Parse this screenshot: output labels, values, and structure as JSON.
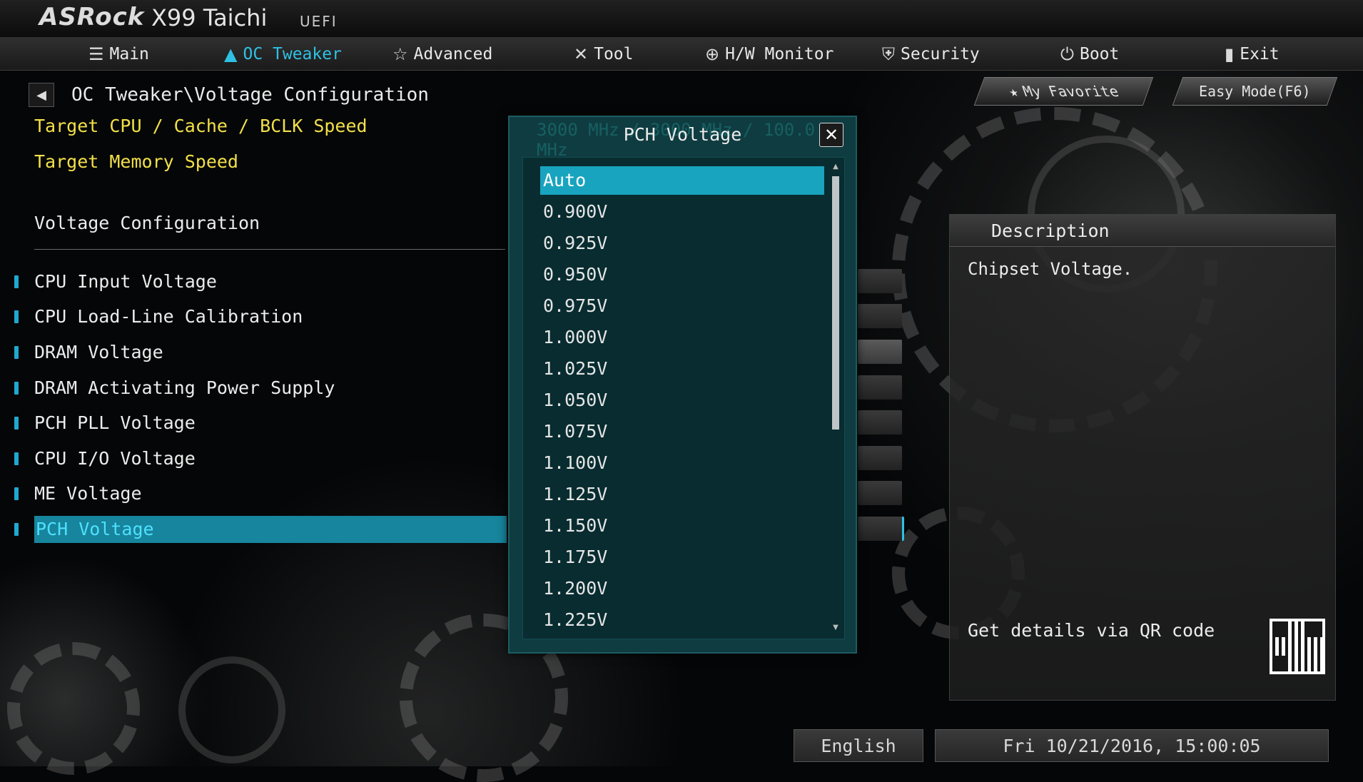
{
  "header": {
    "brand": "ASRock",
    "model": "X99 Taichi",
    "uefi": "UEFI"
  },
  "tabs": [
    {
      "label": "Main",
      "icon": "list-icon"
    },
    {
      "label": "OC Tweaker",
      "icon": "rocket-icon",
      "active": true
    },
    {
      "label": "Advanced",
      "icon": "star-icon"
    },
    {
      "label": "Tool",
      "icon": "tools-icon"
    },
    {
      "label": "H/W Monitor",
      "icon": "crosshair-icon"
    },
    {
      "label": "Security",
      "icon": "shield-icon"
    },
    {
      "label": "Boot",
      "icon": "power-icon"
    },
    {
      "label": "Exit",
      "icon": "exit-door-icon"
    }
  ],
  "breadcrumb": "OC Tweaker\\Voltage Configuration",
  "target_cpu": "Target CPU / Cache / BCLK Speed",
  "target_memory": "Target Memory Speed",
  "section_title": "Voltage Configuration",
  "items": [
    "CPU Input Voltage",
    "CPU Load-Line Calibration",
    "DRAM Voltage",
    "DRAM Activating Power Supply",
    "PCH PLL Voltage",
    "CPU I/O Voltage",
    "ME Voltage",
    "PCH Voltage"
  ],
  "selected_item": "PCH Voltage",
  "top_buttons": {
    "favorite": "My Favorite",
    "easy_mode": "Easy Mode(F6)"
  },
  "description": {
    "title": "Description",
    "text": "Chipset Voltage.",
    "qr_label": "Get details via QR code"
  },
  "status": {
    "language": "English",
    "datetime": "Fri 10/21/2016, 15:00:05"
  },
  "modal": {
    "title": "PCH Voltage",
    "ghost_text": "3000 MHz / 3000 MHz / 100.0 MHz",
    "options": [
      "Auto",
      "0.900V",
      "0.925V",
      "0.950V",
      "0.975V",
      "1.000V",
      "1.025V",
      "1.050V",
      "1.075V",
      "1.100V",
      "1.125V",
      "1.150V",
      "1.175V",
      "1.200V",
      "1.225V"
    ],
    "selected": "Auto",
    "close_icon": "close-x-icon"
  },
  "colors": {
    "accent": "#2fc1e4",
    "highlight": "#17859d",
    "yellow": "#f2e04a",
    "modal_bg": "#0f3c41"
  }
}
